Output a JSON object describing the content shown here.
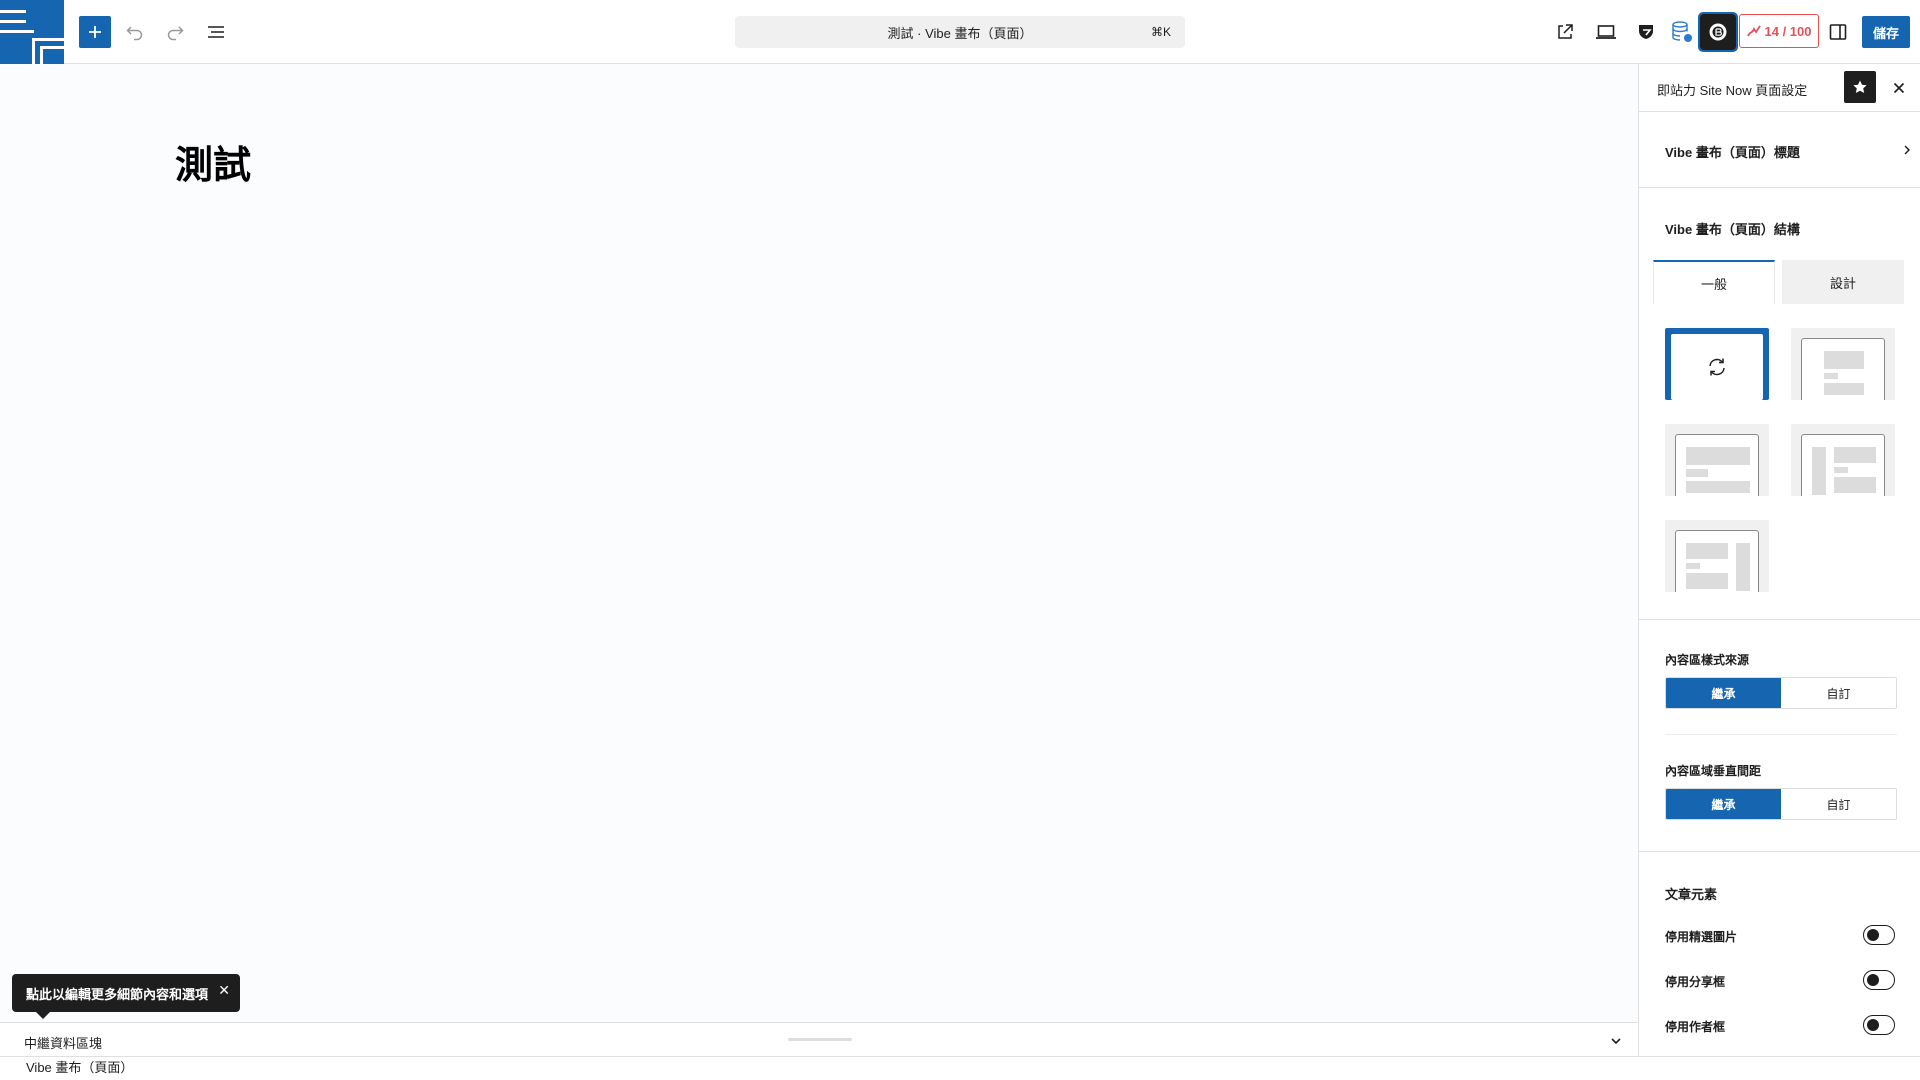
{
  "topbar": {
    "logo_icon": "site-logo-icon",
    "add_block_icon": "plus-icon",
    "undo_icon": "undo-icon",
    "redo_icon": "redo-icon",
    "document_overview_icon": "list-view-icon",
    "command_bar_text": "測試 · Vibe 畫布（頁面）",
    "command_shortcut": "⌘K",
    "view_page_icon": "external-link-icon",
    "preview_icon": "desktop-icon",
    "plugin_icons": [
      "shield-icon",
      "database-icon",
      "plugin-icon"
    ],
    "score": "14 / 100",
    "settings_icon": "sidebar-toggle-icon",
    "save_label": "儲存",
    "accent_color": "#1565b0",
    "score_color": "#e65054"
  },
  "canvas": {
    "heading": "測試"
  },
  "tooltip": {
    "text": "點此以編輯更多細節內容和選項",
    "close_icon": "close-icon"
  },
  "meta_panel": {
    "label": "中繼資料區塊",
    "toggle_icon": "chevron-down-icon"
  },
  "footer": {
    "breadcrumb": "Vibe 畫布（頁面）"
  },
  "sidebar": {
    "header_title": "即站力 Site Now 頁面設定",
    "pin_icon": "star-icon",
    "close_icon": "close-icon",
    "title_row_label": "Vibe 畫布（頁面）標題",
    "structure_label": "Vibe 畫布（頁面）結構",
    "tabs": [
      {
        "label": "一般",
        "active": true
      },
      {
        "label": "設計",
        "active": false
      }
    ],
    "layouts": [
      {
        "name": "inherit",
        "selected": true
      },
      {
        "name": "narrow-content",
        "selected": false
      },
      {
        "name": "full-content",
        "selected": false
      },
      {
        "name": "left-sidebar",
        "selected": false
      },
      {
        "name": "right-sidebar",
        "selected": false
      }
    ],
    "content_style_source": {
      "label": "內容區樣式來源",
      "options": [
        "繼承",
        "自訂"
      ],
      "selected": "繼承"
    },
    "content_vertical_spacing": {
      "label": "內容區域垂直間距",
      "options": [
        "繼承",
        "自訂"
      ],
      "selected": "繼承"
    },
    "post_elements": {
      "label": "文章元素",
      "toggles": [
        {
          "label": "停用精選圖片",
          "on": false
        },
        {
          "label": "停用分享框",
          "on": false
        },
        {
          "label": "停用作者框",
          "on": false
        }
      ]
    }
  }
}
